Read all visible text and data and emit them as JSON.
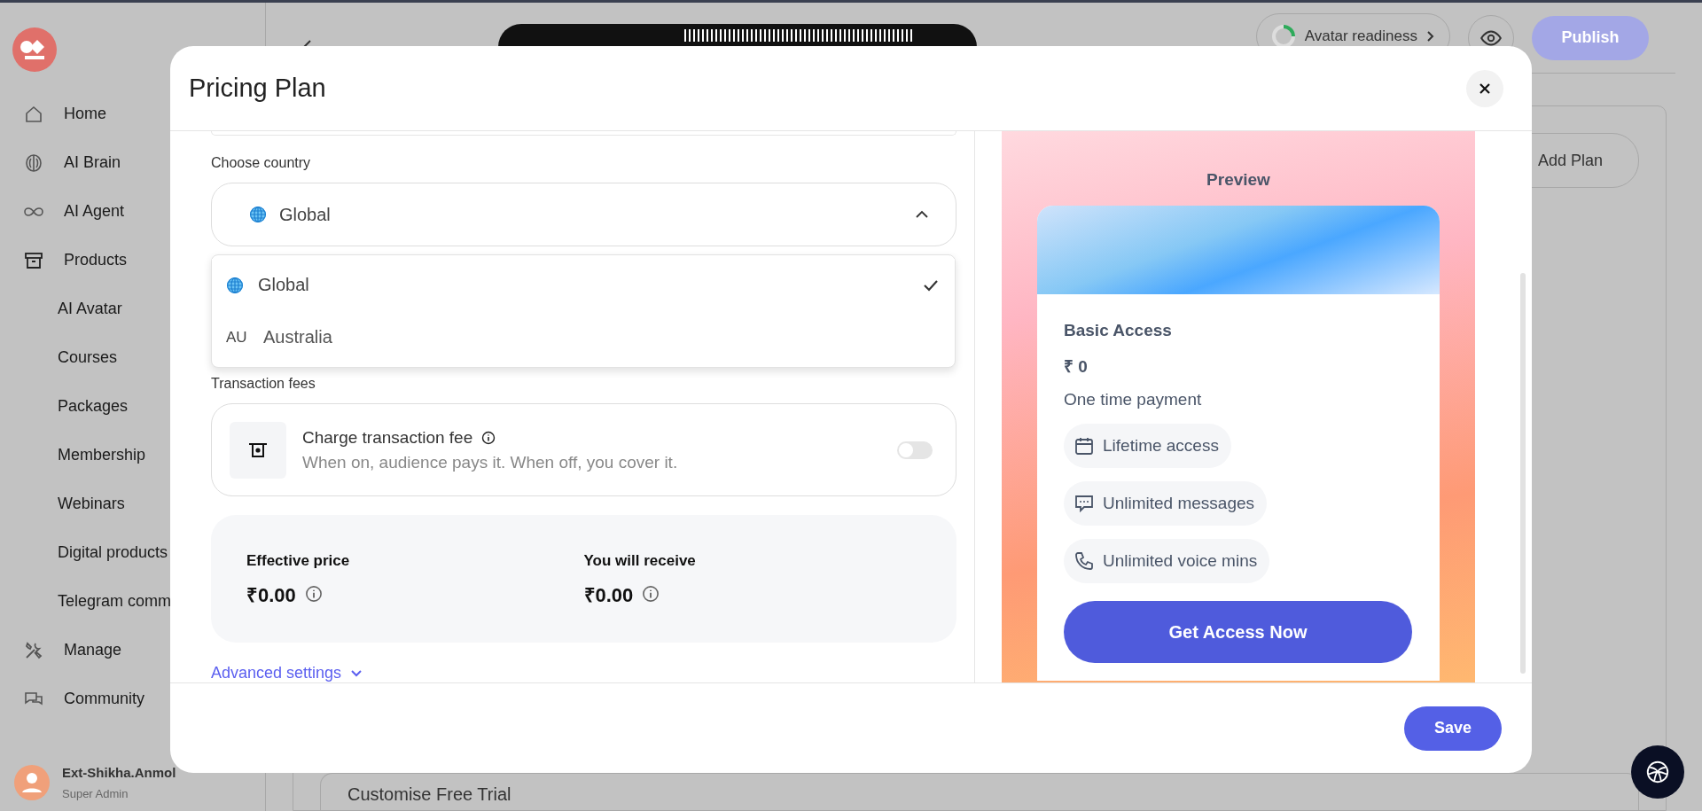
{
  "sidebar": {
    "items": [
      {
        "label": "Home"
      },
      {
        "label": "AI Brain"
      },
      {
        "label": "AI Agent"
      },
      {
        "label": "Products",
        "children": [
          {
            "label": "AI Avatar"
          },
          {
            "label": "Courses"
          },
          {
            "label": "Packages"
          },
          {
            "label": "Membership"
          },
          {
            "label": "Webinars"
          },
          {
            "label": "Digital products"
          },
          {
            "label": "Telegram comm"
          }
        ]
      },
      {
        "label": "Manage"
      },
      {
        "label": "Community"
      }
    ]
  },
  "user": {
    "name": "Ext-Shikha.Anmol",
    "role": "Super Admin"
  },
  "header": {
    "readiness": "Avatar readiness",
    "publish": "Publish"
  },
  "plans": {
    "add_button": "Add Plan",
    "trial": "Customise Free Trial"
  },
  "modal": {
    "title": "Pricing Plan",
    "country": {
      "label": "Choose country",
      "value": "Global",
      "expanded": true,
      "options": [
        {
          "kind": "globe",
          "label": "Global",
          "selected": true
        },
        {
          "kind": "code",
          "code": "AU",
          "label": "Australia",
          "selected": false
        }
      ]
    },
    "transaction": {
      "label": "Transaction fees",
      "title": "Charge transaction fee",
      "description": "When on, audience pays it. When off, you cover it.",
      "on": false
    },
    "summary": [
      {
        "label": "Effective price",
        "amount": "₹0.00"
      },
      {
        "label": "You will receive",
        "amount": "₹0.00"
      }
    ],
    "advanced": "Advanced settings",
    "preview": {
      "heading": "Preview",
      "plan": "Basic Access",
      "price": "₹ 0",
      "billing": "One time payment",
      "features": [
        "Lifetime access",
        "Unlimited messages",
        "Unlimited voice mins"
      ],
      "cta": "Get Access Now"
    },
    "save": "Save"
  }
}
